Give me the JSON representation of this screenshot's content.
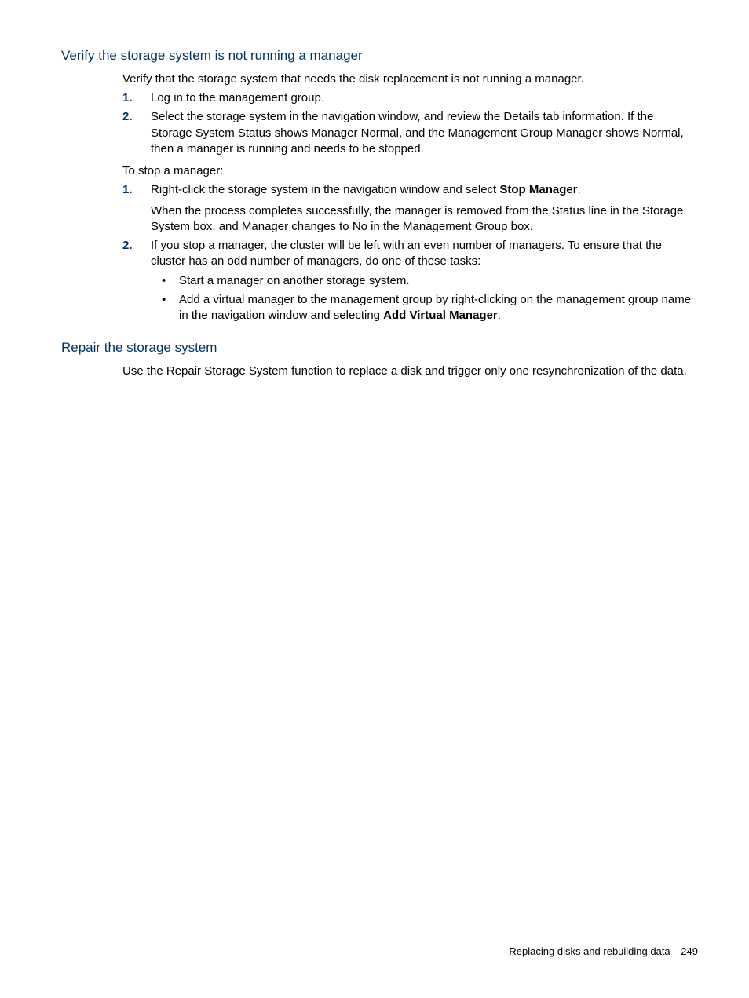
{
  "section1": {
    "heading": "Verify the storage system is not running a manager",
    "intro": "Verify that the storage system that needs the disk replacement is not running a manager.",
    "list1": {
      "item1": "Log in to the management group.",
      "item2": "Select the storage system in the navigation window, and review the Details tab information. If the Storage System Status shows Manager Normal, and the Management Group Manager shows Normal, then a manager is running and needs to be stopped."
    },
    "stopIntro": "To stop a manager:",
    "list2": {
      "item1_prefix": "Right-click the storage system in the navigation window and select ",
      "item1_bold": "Stop Manager",
      "item1_suffix": ".",
      "item1_sub": "When the process completes successfully, the manager is removed from the Status line in the Storage System box, and Manager changes to No in the Management Group box.",
      "item2": "If you stop a manager, the cluster will be left with an even number of managers. To ensure that the cluster has an odd number of managers, do one of these tasks:",
      "bullets": {
        "b1": "Start a manager on another storage system.",
        "b2_prefix": "Add a virtual manager to the management group by right-clicking on the management group name in the navigation window and selecting ",
        "b2_bold": "Add Virtual Manager",
        "b2_suffix": "."
      }
    }
  },
  "section2": {
    "heading": "Repair the storage system",
    "body": "Use the Repair Storage System function to replace a disk and trigger only one resynchronization of the data."
  },
  "footer": {
    "title": "Replacing disks and rebuilding data",
    "page": "249"
  }
}
